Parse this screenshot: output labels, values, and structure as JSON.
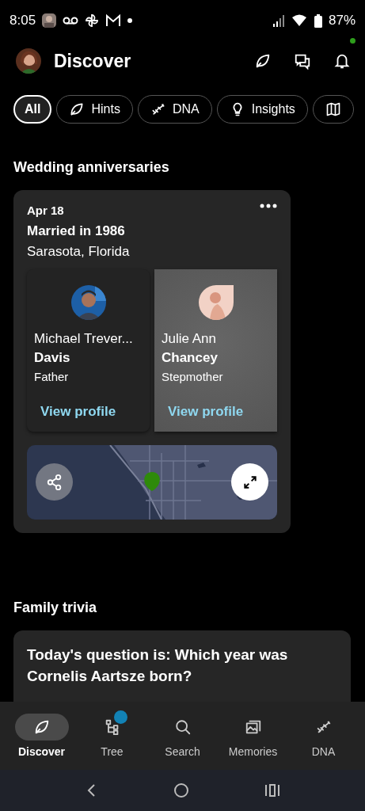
{
  "status_bar": {
    "time": "8:05",
    "battery": "87%"
  },
  "header": {
    "title": "Discover",
    "notification_dot": true
  },
  "filters": [
    {
      "label": "All",
      "selected": true
    },
    {
      "label": "Hints",
      "selected": false
    },
    {
      "label": "DNA",
      "selected": false
    },
    {
      "label": "Insights",
      "selected": false
    },
    {
      "selected": false
    }
  ],
  "sections": [
    {
      "title": "Wedding anniversaries",
      "kind": "anniversary",
      "date": "Apr 18",
      "event": "Married in 1986",
      "place": "Sarasota, Florida",
      "people": [
        {
          "given": "Michael Trever...",
          "surname": "Davis",
          "relation": "Father",
          "link": "View profile",
          "selected": false
        },
        {
          "given": "Julie Ann",
          "surname": "Chancey",
          "relation": "Stepmother",
          "link": "View profile",
          "selected": true
        }
      ]
    },
    {
      "title": "Family trivia",
      "kind": "trivia",
      "question": "Today's question is: Which year was Cornelis Aartsze born?"
    }
  ],
  "bottom_nav": [
    {
      "label": "Discover",
      "selected": true,
      "badge": false
    },
    {
      "label": "Tree",
      "selected": false,
      "badge": true
    },
    {
      "label": "Search",
      "selected": false,
      "badge": false
    },
    {
      "label": "Memories",
      "selected": false,
      "badge": false
    },
    {
      "label": "DNA",
      "selected": false,
      "badge": false
    }
  ]
}
